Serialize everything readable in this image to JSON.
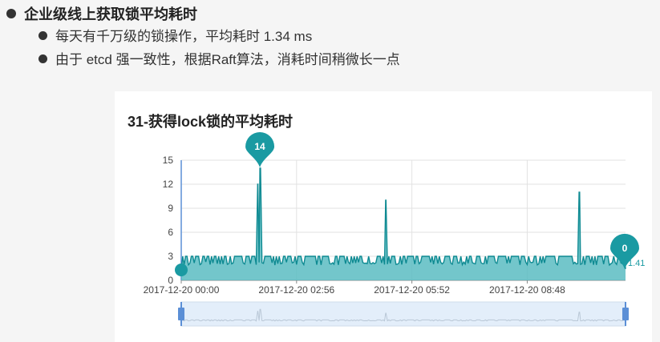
{
  "slide": {
    "heading": "企业级线上获取锁平均耗时",
    "sub1": "每天有千万级的锁操作，平均耗时 1.34 ms",
    "sub2": "由于 etcd 强一致性，根据Raft算法，消耗时间稍微长一点"
  },
  "chart_data": {
    "type": "area",
    "title": "31-获得lock锁的平均耗时",
    "xlabel": "",
    "ylabel": "",
    "ylim": [
      0,
      15
    ],
    "yticks": [
      0,
      3,
      6,
      9,
      12,
      15
    ],
    "xticks": [
      "2017-12-20 00:00",
      "2017-12-20 02:56",
      "2017-12-20 05:52",
      "2017-12-20 08:48"
    ],
    "x_range": [
      "2017-12-20 00:00",
      "2017-12-20 11:18"
    ],
    "series": [
      {
        "baseline_low": 1.9,
        "baseline_high": 3.0,
        "spikes": [
          {
            "x": "2017-12-20 01:57",
            "y": 12
          },
          {
            "x": "2017-12-20 02:00",
            "y": 14
          },
          {
            "x": "2017-12-20 05:12",
            "y": 10
          },
          {
            "x": "2017-12-20 10:08",
            "y": 11
          }
        ],
        "first_value": 1.3,
        "last_value": 1.41
      }
    ],
    "markers": [
      {
        "label": "14",
        "x": "2017-12-20 02:00",
        "y": 14
      },
      {
        "label": "0",
        "x": "2017-12-20 11:18",
        "y": 1.41
      }
    ],
    "last_value_label": "1.41",
    "grid": true,
    "colors": {
      "line": "#0e8a92",
      "fill": "#5bbcc2",
      "pin": "#1a9aa2",
      "zoom_bg": "#e3eefa",
      "zoom_handle": "#5b8fd6"
    }
  }
}
